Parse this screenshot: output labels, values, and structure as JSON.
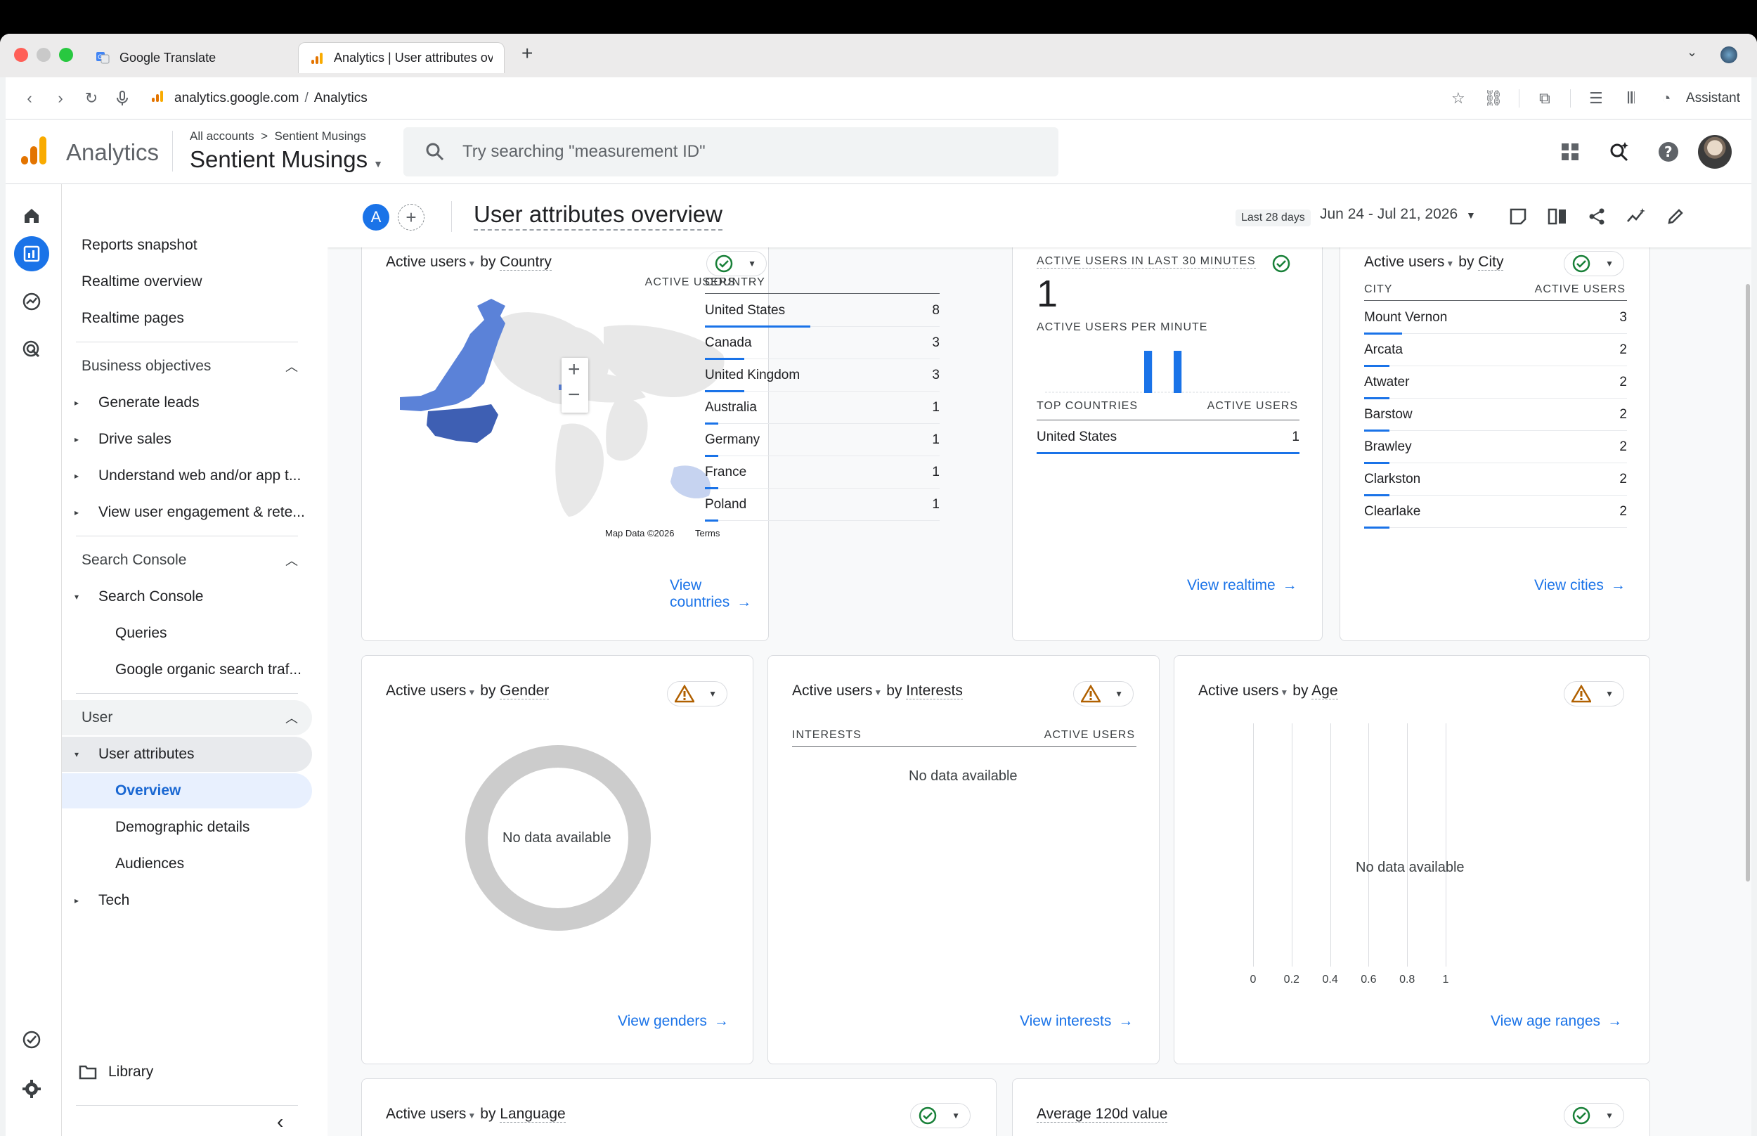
{
  "browser": {
    "tabs": [
      {
        "label": "Google Translate",
        "active": false
      },
      {
        "label": "Analytics | User attributes ov",
        "active": true
      }
    ],
    "url_host": "analytics.google.com",
    "url_path": "Analytics",
    "assistant_label": "Assistant"
  },
  "header": {
    "product": "Analytics",
    "account_path": [
      "All accounts",
      "Sentient Musings"
    ],
    "property": "Sentient Musings",
    "search_placeholder": "Try searching \"measurement ID\""
  },
  "sidenav": {
    "top_items": [
      "Reports snapshot",
      "Realtime overview",
      "Realtime pages"
    ],
    "business_objectives": {
      "title": "Business objectives",
      "items": [
        "Generate leads",
        "Drive sales",
        "Understand web and/or app t...",
        "View user engagement & rete..."
      ]
    },
    "search_console": {
      "title": "Search Console",
      "group": "Search Console",
      "items": [
        "Queries",
        "Google organic search traf..."
      ]
    },
    "user": {
      "title": "User",
      "group": "User attributes",
      "items": [
        "Overview",
        "Demographic details",
        "Audiences"
      ],
      "selected": "Overview",
      "tech": "Tech"
    },
    "library": "Library"
  },
  "topbar": {
    "compare_badge": "A",
    "title": "User attributes overview",
    "date_label": "Last 28 days",
    "date_range": "Jun 24 - Jul 21, 2026"
  },
  "cards": {
    "country": {
      "metric": "Active users",
      "by": "by",
      "dimension": "Country",
      "col1": "COUNTRY",
      "col2": "ACTIVE USERS",
      "rows": [
        {
          "k": "United States",
          "v": "8",
          "frac": 1.0
        },
        {
          "k": "Canada",
          "v": "3",
          "frac": 0.375
        },
        {
          "k": "United Kingdom",
          "v": "3",
          "frac": 0.375
        },
        {
          "k": "Australia",
          "v": "1",
          "frac": 0.125
        },
        {
          "k": "Germany",
          "v": "1",
          "frac": 0.125
        },
        {
          "k": "France",
          "v": "1",
          "frac": 0.125
        },
        {
          "k": "Poland",
          "v": "1",
          "frac": 0.125
        }
      ],
      "map_credit": "Map Data ©2026",
      "map_terms": "Terms",
      "link": "View countries"
    },
    "realtime": {
      "title": "ACTIVE USERS IN LAST 30 MINUTES",
      "value": "1",
      "per_minute": "ACTIVE USERS PER MINUTE",
      "per_minute_values": [
        0,
        0,
        0,
        0,
        0,
        0,
        0,
        0,
        0,
        0,
        0,
        0,
        0,
        0,
        0,
        0,
        0,
        0,
        0,
        0,
        1,
        0,
        0,
        0,
        0,
        0,
        1,
        0,
        0,
        0,
        0,
        0,
        0,
        0,
        0,
        0,
        0,
        0,
        0,
        0,
        0,
        0,
        0,
        0,
        0,
        0,
        0,
        0,
        0,
        0
      ],
      "col1": "TOP COUNTRIES",
      "col2": "ACTIVE USERS",
      "rows": [
        {
          "k": "United States",
          "v": "1",
          "frac": 1.0
        }
      ],
      "link": "View realtime"
    },
    "city": {
      "metric": "Active users",
      "by": "by",
      "dimension": "City",
      "col1": "CITY",
      "col2": "ACTIVE USERS",
      "rows": [
        {
          "k": "Mount Vernon",
          "v": "3",
          "frac": 1.0
        },
        {
          "k": "Arcata",
          "v": "2",
          "frac": 0.667
        },
        {
          "k": "Atwater",
          "v": "2",
          "frac": 0.667
        },
        {
          "k": "Barstow",
          "v": "2",
          "frac": 0.667
        },
        {
          "k": "Brawley",
          "v": "2",
          "frac": 0.667
        },
        {
          "k": "Clarkston",
          "v": "2",
          "frac": 0.667
        },
        {
          "k": "Clearlake",
          "v": "2",
          "frac": 0.667
        }
      ],
      "link": "View cities"
    },
    "gender": {
      "metric": "Active users",
      "by": "by",
      "dimension": "Gender",
      "nodata": "No data available",
      "link": "View genders"
    },
    "interests": {
      "metric": "Active users",
      "by": "by",
      "dimension": "Interests",
      "col1": "INTERESTS",
      "col2": "ACTIVE USERS",
      "nodata": "No data available",
      "link": "View interests"
    },
    "age": {
      "metric": "Active users",
      "by": "by",
      "dimension": "Age",
      "nodata": "No data available",
      "ticks": [
        "0",
        "0.2",
        "0.4",
        "0.6",
        "0.8",
        "1"
      ],
      "link": "View age ranges"
    },
    "language": {
      "metric": "Active users",
      "by": "by",
      "dimension": "Language"
    },
    "avg_value": {
      "title": "Average 120d value"
    }
  },
  "colors": {
    "accent": "#1a73e8",
    "ok": "#188038",
    "warn": "#b06000"
  }
}
